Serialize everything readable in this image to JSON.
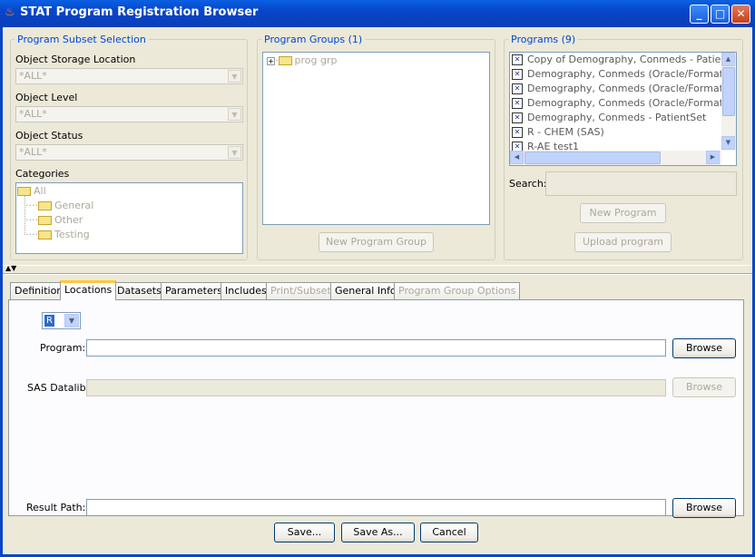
{
  "window": {
    "title": "STAT Program Registration Browser"
  },
  "subset": {
    "title": "Program Subset Selection",
    "storage_label": "Object Storage Location",
    "storage_value": "*ALL*",
    "level_label": "Object Level",
    "level_value": "*ALL*",
    "status_label": "Object Status",
    "status_value": "*ALL*",
    "categories_label": "Categories",
    "categories": {
      "root": "All",
      "children": [
        "General",
        "Other",
        "Testing"
      ]
    }
  },
  "groups": {
    "title": "Program Groups (1)",
    "items": [
      "prog grp"
    ],
    "new_button": "New Program Group"
  },
  "programs": {
    "title": "Programs (9)",
    "items": [
      "Copy of Demography, Conmeds - PatientSet",
      "Demography, Conmeds (Oracle/Formats) - p",
      "Demography, Conmeds (Oracle/Formats) - p",
      "Demography, Conmeds (Oracle/Formats) - p",
      "Demography, Conmeds - PatientSet",
      "R - CHEM (SAS)",
      "R-AE test1"
    ],
    "search_label": "Search:",
    "search_value": "",
    "new_button": "New Program",
    "upload_button": "Upload program"
  },
  "tabs": [
    {
      "label": "Definition",
      "enabled": true
    },
    {
      "label": "Locations",
      "enabled": true,
      "active": true
    },
    {
      "label": "Datasets",
      "enabled": true
    },
    {
      "label": "Parameters",
      "enabled": true
    },
    {
      "label": "Includes",
      "enabled": true
    },
    {
      "label": "Print/Subset",
      "enabled": false
    },
    {
      "label": "General Info",
      "enabled": true
    },
    {
      "label": "Program Group Options",
      "enabled": false
    }
  ],
  "locations": {
    "type_value": "R",
    "program_label": "Program:",
    "program_value": "",
    "sas_datalib_label": "SAS Datalib:",
    "sas_datalib_value": "",
    "result_path_label": "Result Path:",
    "result_path_value": "",
    "browse_label": "Browse"
  },
  "footer": {
    "save": "Save...",
    "save_as": "Save As...",
    "cancel": "Cancel"
  },
  "colors": {
    "title_bar": "#0845c8",
    "group_title": "#0046d5",
    "active_tab": "#ffc83c",
    "selection": "#316ac5"
  }
}
